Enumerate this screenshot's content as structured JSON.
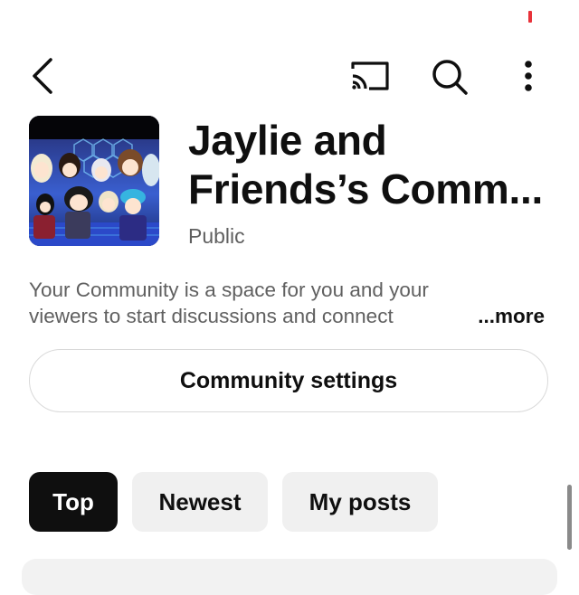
{
  "toolbar": {
    "back_icon": "chevron-left-icon",
    "cast_icon": "cast-icon",
    "search_icon": "search-icon",
    "more_icon": "more-vertical-icon"
  },
  "community": {
    "title_line1": "Jaylie and",
    "title_line2": "Friends’s Comm...",
    "privacy": "Public",
    "description_line1": "Your Community is a space for you and your",
    "description_line2": "viewers to start discussions and connect",
    "more_label": "...more"
  },
  "actions": {
    "settings_label": "Community settings"
  },
  "tabs": [
    {
      "label": "Top",
      "active": true
    },
    {
      "label": "Newest",
      "active": false
    },
    {
      "label": "My posts",
      "active": false
    }
  ],
  "colors": {
    "primary_text": "#0f0f0f",
    "secondary_text": "#606060",
    "chip_inactive_bg": "#f0f0f0",
    "status_mark": "#e8323a"
  }
}
